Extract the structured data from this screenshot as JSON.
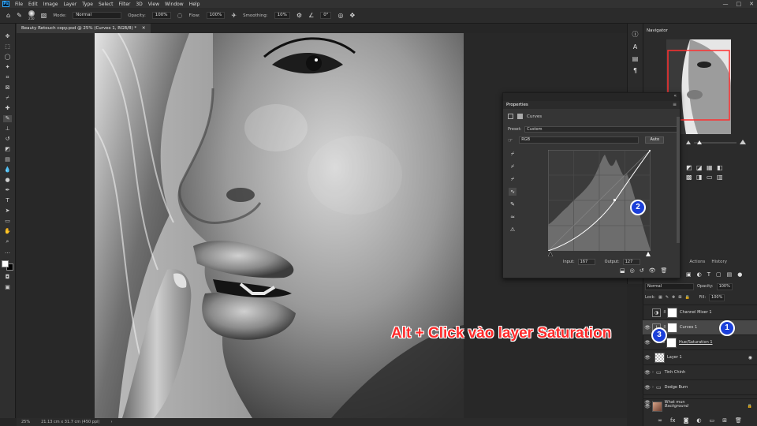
{
  "menubar": {
    "logo": "Ps",
    "items": [
      "File",
      "Edit",
      "Image",
      "Layer",
      "Type",
      "Select",
      "Filter",
      "3D",
      "View",
      "Window",
      "Help"
    ],
    "window_controls": [
      "—",
      "□",
      "✕"
    ]
  },
  "options_bar": {
    "brush_size": "250",
    "mode_label": "Mode:",
    "mode_value": "Normal",
    "opacity_label": "Opacity:",
    "opacity_value": "100%",
    "flow_label": "Flow:",
    "flow_value": "100%",
    "smoothing_label": "Smoothing:",
    "smoothing_value": "10%",
    "angle_value": "0°"
  },
  "document": {
    "tab_title": "Beauty Retouch copy.psd @ 25% (Curves 1, RGB/8) *",
    "zoom": "25%",
    "doc_size": "21.13 cm x 31.7 cm (450 ppi)"
  },
  "navigator": {
    "title": "Navigator"
  },
  "layers_panel": {
    "tabs": [
      "Actions",
      "History"
    ],
    "blend_mode": "Normal",
    "opacity_label": "Opacity:",
    "opacity_value": "100%",
    "lock_label": "Lock:",
    "fill_label": "Fill:",
    "fill_value": "100%",
    "layers": [
      {
        "name": "Channel Mixer 1",
        "kind": "adjustment",
        "visible": false
      },
      {
        "name": "Curves 1",
        "kind": "adjustment",
        "visible": true,
        "selected": true
      },
      {
        "name": "Hue/Saturation 1",
        "kind": "adjustment",
        "visible": true
      },
      {
        "name": "Layer 1",
        "kind": "pixel",
        "visible": true
      },
      {
        "name": "Tinh Chinh",
        "kind": "group",
        "visible": true
      },
      {
        "name": "Dodge Burn",
        "kind": "group",
        "visible": true
      },
      {
        "name": "What mun",
        "kind": "group",
        "visible": true
      },
      {
        "name": "Background",
        "kind": "background",
        "visible": true
      }
    ]
  },
  "properties_panel": {
    "title": "Properties",
    "type_label": "Curves",
    "preset_label": "Preset:",
    "preset_value": "Custom",
    "channel_value": "RGB",
    "auto_label": "Auto",
    "input_label": "Input:",
    "input_value": "167",
    "output_label": "Output:",
    "output_value": "127"
  },
  "annotations": {
    "callout_text": "Alt + Click vào layer Saturation",
    "badges": [
      "1",
      "2",
      "3"
    ],
    "badge_color": "#1b3fd9",
    "callout_color": "#ff2a2a"
  },
  "colors": {
    "ui_dark": "#262626",
    "panel": "#2b2b2b",
    "selected_layer": "#484848",
    "navigator_frame": "#ff3030"
  }
}
